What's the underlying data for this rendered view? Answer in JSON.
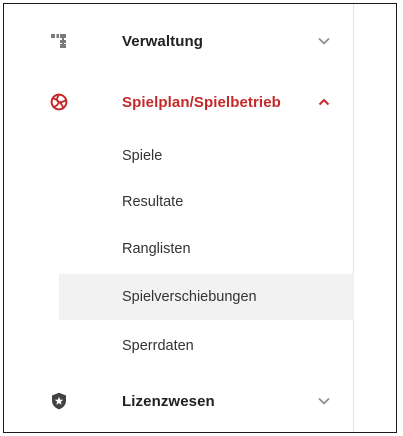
{
  "nav": {
    "sections": [
      {
        "label": "Verwaltung",
        "icon": "org-chart-icon",
        "expanded": false
      },
      {
        "label": "Spielplan/Spielbetrieb",
        "icon": "volleyball-icon",
        "expanded": true,
        "accent": "#c62828"
      },
      {
        "label": "Lizenzwesen",
        "icon": "shield-star-icon",
        "expanded": false
      }
    ],
    "subitems": [
      {
        "label": "Spiele"
      },
      {
        "label": "Resultate"
      },
      {
        "label": "Ranglisten"
      },
      {
        "label": "Spielverschiebungen",
        "selected": true
      },
      {
        "label": "Sperrdaten"
      }
    ]
  }
}
